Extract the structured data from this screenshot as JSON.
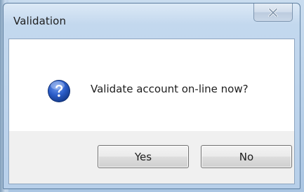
{
  "window": {
    "title": "Validation",
    "close_label": "Close"
  },
  "dialog": {
    "icon": "question-icon",
    "message": "Validate account on-line now?"
  },
  "buttons": {
    "yes_label": "Yes",
    "no_label": "No"
  },
  "colors": {
    "frame": "#b9d1ea",
    "client_background": "#f0f0f0",
    "message_area": "#ffffff",
    "question_icon": "#1f4fb0"
  }
}
